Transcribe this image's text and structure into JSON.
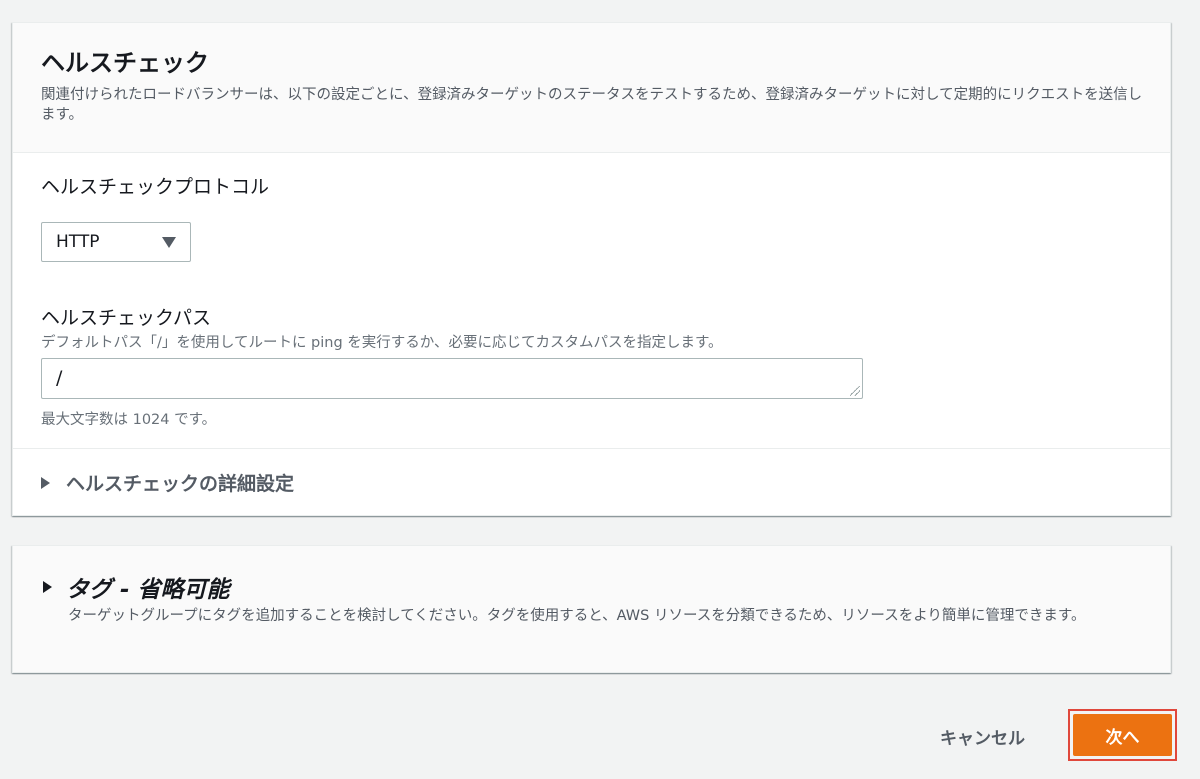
{
  "health_check": {
    "title": "ヘルスチェック",
    "description": "関連付けられたロードバランサーは、以下の設定ごとに、登録済みターゲットのステータスをテストするため、登録済みターゲットに対して定期的にリクエストを送信します。",
    "protocol": {
      "label": "ヘルスチェックプロトコル",
      "selected": "HTTP"
    },
    "path": {
      "label": "ヘルスチェックパス",
      "hint": "デフォルトパス「/」を使用してルートに ping を実行するか、必要に応じてカスタムパスを指定します。",
      "value": "/",
      "constraint": "最大文字数は 1024 です。"
    },
    "advanced": {
      "label": "ヘルスチェックの詳細設定"
    }
  },
  "tags": {
    "title": "タグ - 省略可能",
    "description": "ターゲットグループにタグを追加することを検討してください。タグを使用すると、AWS リソースを分類できるため、リソースをより簡単に管理できます。"
  },
  "footer": {
    "cancel_label": "キャンセル",
    "next_label": "次へ"
  },
  "colors": {
    "primary_button": "#ec7211",
    "highlight_border": "#e0473b",
    "page_background": "#f2f3f3"
  },
  "icons": {
    "dropdown": "caret-down-icon",
    "expand": "triangle-right-icon",
    "resize": "resize-handle-icon"
  }
}
